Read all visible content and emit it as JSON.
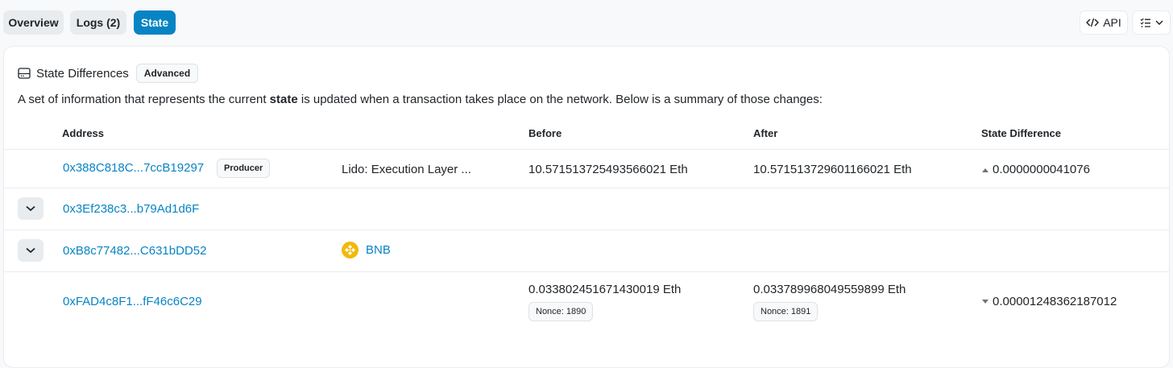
{
  "tabs": [
    {
      "label": "Overview"
    },
    {
      "label": "Logs (2)"
    },
    {
      "label": "State"
    }
  ],
  "toolbar": {
    "api_label": "API"
  },
  "card": {
    "title": "State Differences",
    "badge": "Advanced",
    "description_before": "A set of information that represents the current ",
    "description_bold": "state",
    "description_after": " is updated when a transaction takes place on the network. Below is a summary of those changes:"
  },
  "table": {
    "headers": {
      "address": "Address",
      "before": "Before",
      "after": "After",
      "state_difference": "State Difference"
    },
    "rows": [
      {
        "address": "0x388C818C...7ccB19297",
        "tag": "Producer",
        "name": "Lido: Execution Layer ...",
        "before": "10.571513725493566021 Eth",
        "after": "10.571513729601166021 Eth",
        "difference": "0.0000000041076",
        "direction": "up"
      },
      {
        "address": "0x3Ef238c3...b79Ad1d6F"
      },
      {
        "address": "0xB8c77482...C631bDD52",
        "token": "BNB"
      },
      {
        "address": "0xFAD4c8F1...fF46c6C29",
        "before": "0.033802451671430019 Eth",
        "before_nonce": "Nonce: 1890",
        "after": "0.033789968049559899 Eth",
        "after_nonce": "Nonce: 1891",
        "difference": "0.00001248362187012",
        "direction": "down"
      }
    ]
  },
  "colors": {
    "accent": "#0784c3",
    "bnb": "#f0b90b"
  }
}
